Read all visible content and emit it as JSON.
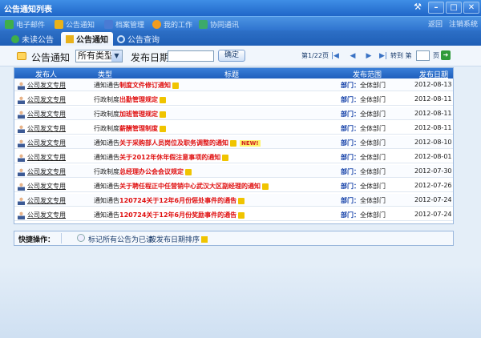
{
  "window": {
    "title": "公告通知列表"
  },
  "toolbar": {
    "items": [
      {
        "label": "电子邮件",
        "icon": "mail-icon",
        "color": "#3fae4a"
      },
      {
        "label": "公告通知",
        "icon": "bell-icon",
        "color": "#e9b21a"
      },
      {
        "label": "档案管理",
        "icon": "archive-icon",
        "color": "#4a7bd4"
      },
      {
        "label": "我的工作",
        "icon": "work-icon",
        "color": "#f19c1f"
      },
      {
        "label": "协同通讯",
        "icon": "people-icon",
        "color": "#3caa6b"
      }
    ],
    "right": {
      "home": "返回",
      "exit": "注销系统"
    }
  },
  "tabs": [
    {
      "label": "未读公告",
      "icon": "unread-icon"
    },
    {
      "label": "公告通知",
      "icon": "notice-icon"
    },
    {
      "label": "公告查询",
      "icon": "search-icon"
    }
  ],
  "filter": {
    "title": "公告通知",
    "type_select": "所有类型",
    "date_label": "发布日期",
    "date_value": "",
    "confirm_button": "确定"
  },
  "pager": {
    "info": "第1/22页",
    "goto_label": "转到 第",
    "page_unit": "页"
  },
  "table": {
    "headers": {
      "publisher": "发布人",
      "type": "类型",
      "title": "标题",
      "scope": "发布范围",
      "date": "发布日期"
    },
    "rows": [
      {
        "publisher": "公司发文专用",
        "type": "通知通告",
        "title": "制度文件修订通知",
        "new": false,
        "scope_prefix": "部门：",
        "scope": "全体部门",
        "date": "2012-08-13"
      },
      {
        "publisher": "公司发文专用",
        "type": "行政制度",
        "title": "出勤管理规定",
        "new": false,
        "scope_prefix": "部门：",
        "scope": "全体部门",
        "date": "2012-08-11"
      },
      {
        "publisher": "公司发文专用",
        "type": "行政制度",
        "title": "加班管理规定",
        "new": false,
        "scope_prefix": "部门：",
        "scope": "全体部门",
        "date": "2012-08-11"
      },
      {
        "publisher": "公司发文专用",
        "type": "行政制度",
        "title": "薪酬管理制度",
        "new": false,
        "scope_prefix": "部门：",
        "scope": "全体部门",
        "date": "2012-08-11"
      },
      {
        "publisher": "公司发文专用",
        "type": "通知通告",
        "title": "关于采购部人员岗位及职务调整的通知",
        "new": true,
        "new_label": "NEW!",
        "scope_prefix": "部门：",
        "scope": "全体部门",
        "date": "2012-08-10"
      },
      {
        "publisher": "公司发文专用",
        "type": "通知通告",
        "title": "关于2012年休年假注意事项的通知",
        "new": false,
        "scope_prefix": "部门：",
        "scope": "全体部门",
        "date": "2012-08-01"
      },
      {
        "publisher": "公司发文专用",
        "type": "行政制度",
        "title": "总经理办公会会议规定",
        "new": false,
        "scope_prefix": "部门：",
        "scope": "全体部门",
        "date": "2012-07-30"
      },
      {
        "publisher": "公司发文专用",
        "type": "通知通告",
        "title": "关于聘任程正中任营销中心武汉大区副经理的通知",
        "new": false,
        "scope_prefix": "部门：",
        "scope": "全体部门",
        "date": "2012-07-26"
      },
      {
        "publisher": "公司发文专用",
        "type": "通知通告",
        "title": "120724关于12年6月份惩处事件的通告",
        "new": false,
        "scope_prefix": "部门：",
        "scope": "全体部门",
        "date": "2012-07-24"
      },
      {
        "publisher": "公司发文专用",
        "type": "通知通告",
        "title": "120724关于12年6月份奖励事件的通告",
        "new": false,
        "scope_prefix": "部门：",
        "scope": "全体部门",
        "date": "2012-07-24"
      }
    ]
  },
  "quick_ops": {
    "label": "快捷操作：",
    "mark_all_read": "标记所有公告为已读",
    "sort_by_date": "按发布日期排序"
  },
  "colors": {
    "accent": "#205fbd",
    "title_red": "#e01010",
    "scope_blue": "#1440a8"
  }
}
